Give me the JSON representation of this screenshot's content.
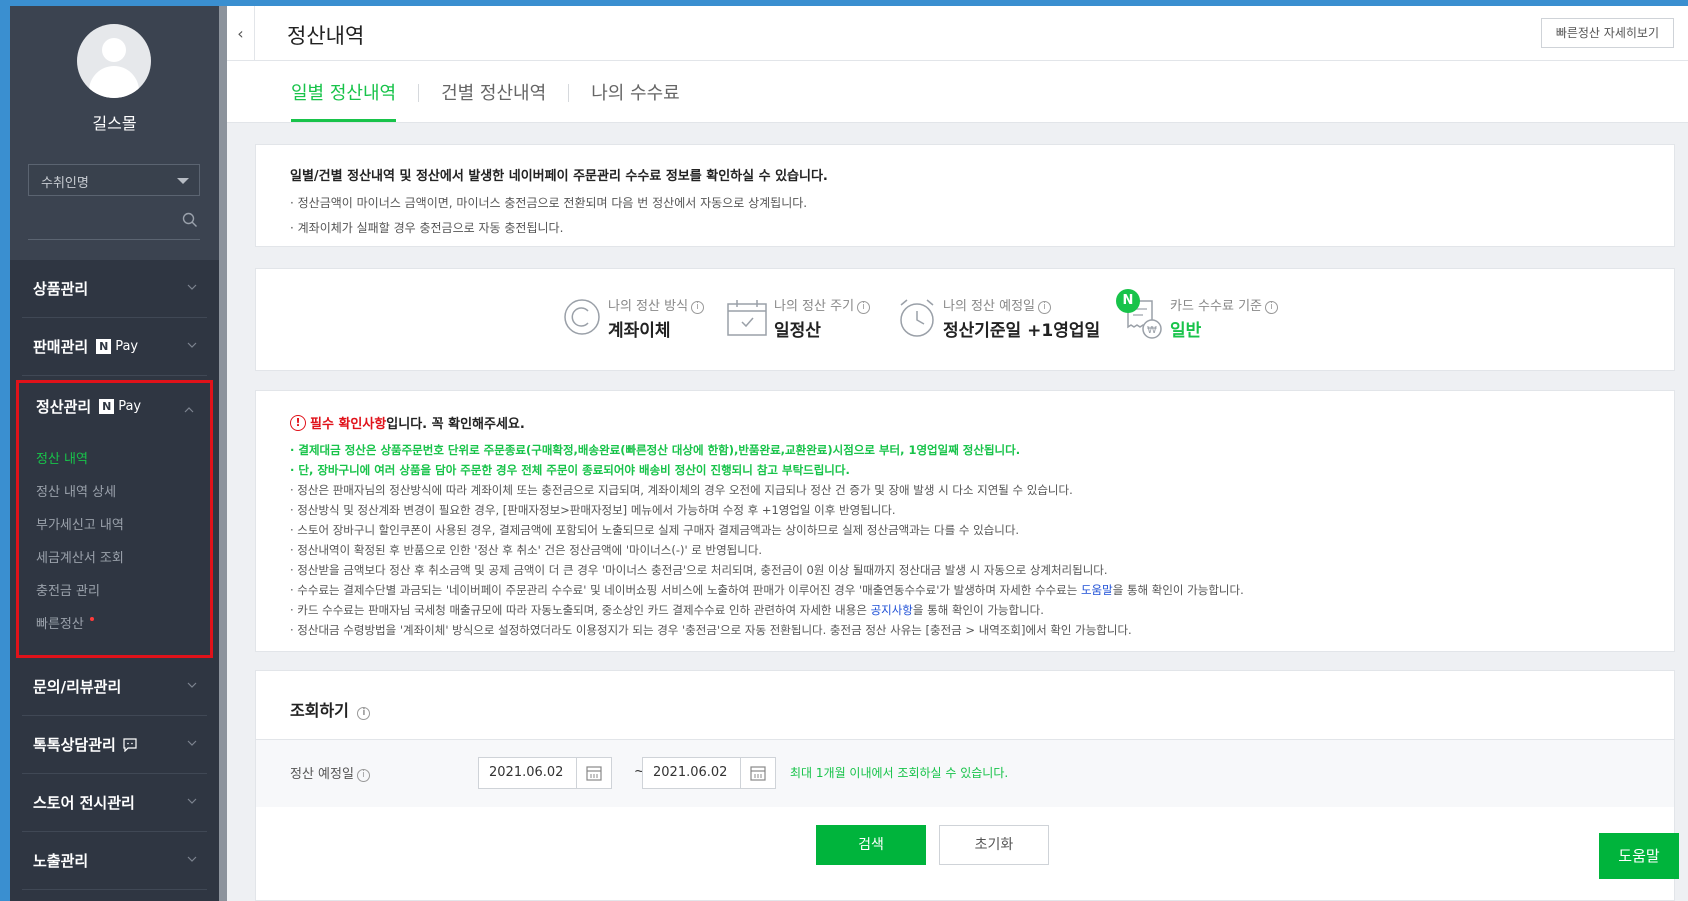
{
  "sidebar": {
    "store_name": "길스몰",
    "recipient_select": "수취인명",
    "menu": [
      {
        "label": "상품관리"
      },
      {
        "label": "판매관리",
        "npay": true
      },
      {
        "label": "정산관리",
        "npay": true,
        "open": true
      },
      {
        "label": "문의/리뷰관리"
      },
      {
        "label": "톡톡상담관리"
      },
      {
        "label": "스토어 전시관리"
      },
      {
        "label": "노출관리"
      }
    ],
    "npay_n": "N",
    "npay_text": "Pay",
    "settlement_sub": [
      "정산 내역",
      "정산 내역 상세",
      "부가세신고 내역",
      "세금계산서 조회",
      "충전금 관리",
      "빠른정산"
    ]
  },
  "header": {
    "back": "‹",
    "title": "정산내역",
    "quick_button": "빠른정산 자세히보기"
  },
  "tabs": [
    "일별 정산내역",
    "건별 정산내역",
    "나의 수수료"
  ],
  "info": {
    "title": "일별/건별 정산내역 및 정산에서 발생한 네이버페이 주문관리 수수료 정보를 확인하실 수 있습니다.",
    "lines": [
      "· 정산금액이 마이너스 금액이면, 마이너스 충전금으로 전환되며 다음 번 정산에서 자동으로 상계됩니다.",
      "· 계좌이체가 실패할 경우 충전금으로 자동 충전됩니다."
    ]
  },
  "stats": [
    {
      "label": "나의 정산 방식",
      "value": "계좌이체",
      "icon": "c-circle-icon"
    },
    {
      "label": "나의 정산 주기",
      "value": "일정산",
      "icon": "calendar-check-icon"
    },
    {
      "label": "나의 정산 예정일",
      "value": "정산기준일 +1영업일",
      "icon": "clock-icon"
    },
    {
      "label": "카드 수수료 기준",
      "value": "일반",
      "icon": "receipt-won-icon",
      "badge": "N"
    }
  ],
  "notice": {
    "head_red": "필수 확인사항",
    "head_rest": "입니다. 꼭 확인해주세요.",
    "green_lines": [
      "· 결제대금 정산은 상품주문번호 단위로 주문종료(구매확정,배송완료(빠른정산 대상에 한함),반품완료,교환완료)시점으로 부터, 1영업일째 정산됩니다.",
      "· 단, 장바구니에 여러 상품을 담아 주문한 경우 전체 주문이 종료되어야 배송비 정산이 진행되니 참고 부탁드립니다."
    ],
    "lines": [
      "· 정산은 판매자님의 정산방식에 따라 계좌이체 또는 충전금으로 지급되며, 계좌이체의 경우 오전에 지급되나 정산 건 증가 및 장애 발생 시 다소 지연될 수 있습니다.",
      "· 정산방식 및 정산계좌 변경이 필요한 경우, [판매자정보>판매자정보] 메뉴에서 가능하며 수정 후 +1영업일 이후 반영됩니다.",
      "· 스토어 장바구니 할인쿠폰이 사용된 경우, 결제금액에 포함되어 노출되므로 실제 구매자 결제금액과는 상이하므로 실제 정산금액과는 다를 수 있습니다.",
      "· 정산내역이 확정된 후 반품으로 인한 '정산 후 취소' 건은 정산금액에 '마이너스(-)' 로 반영됩니다.",
      "· 정산받을 금액보다 정산 후 취소금액 및 공제 금액이 더 큰 경우 '마이너스 충전금'으로 처리되며, 충전금이 0원 이상 될때까지 정산대금 발생 시 자동으로 상계처리됩니다."
    ],
    "fee_line_a": "· 수수료는 결제수단별 과금되는 '네이버페이 주문관리 수수료' 및 네이버쇼핑 서비스에 노출하여 판매가 이루어진 경우 '매출연동수수료'가 발생하며 자세한 수수료는 ",
    "fee_link": "도움말",
    "fee_line_b": "을 통해 확인이 가능합니다.",
    "card_line_a": "· 카드 수수료는 판매자님 국세청 매출규모에 따라 자동노출되며, 중소상인 카드 결제수수료 인하 관련하여 자세한 내용은 ",
    "card_link": "공지사항",
    "card_line_b": "을 통해 확인이 가능합니다.",
    "last_line": "· 정산대금 수령방법을 '계좌이체' 방식으로 설정하였더라도 이용정지가 되는 경우 '충전금'으로 자동 전환됩니다. 충전금 정산 사유는 [충전금 > 내역조회]에서 확인 가능합니다."
  },
  "query": {
    "title": "조회하기",
    "label": "정산 예정일",
    "date_from": "2021.06.02",
    "date_to": "2021.06.02",
    "tilde": "~",
    "hint": "최대 1개월 이내에서 조회하실 수 있습니다.",
    "search_button": "검색",
    "reset_button": "초기화"
  },
  "help_button": "도움말",
  "colors": {
    "accent": "#18c34a",
    "sidebar": "#3b4350",
    "highlight_box": "#e0121a"
  }
}
